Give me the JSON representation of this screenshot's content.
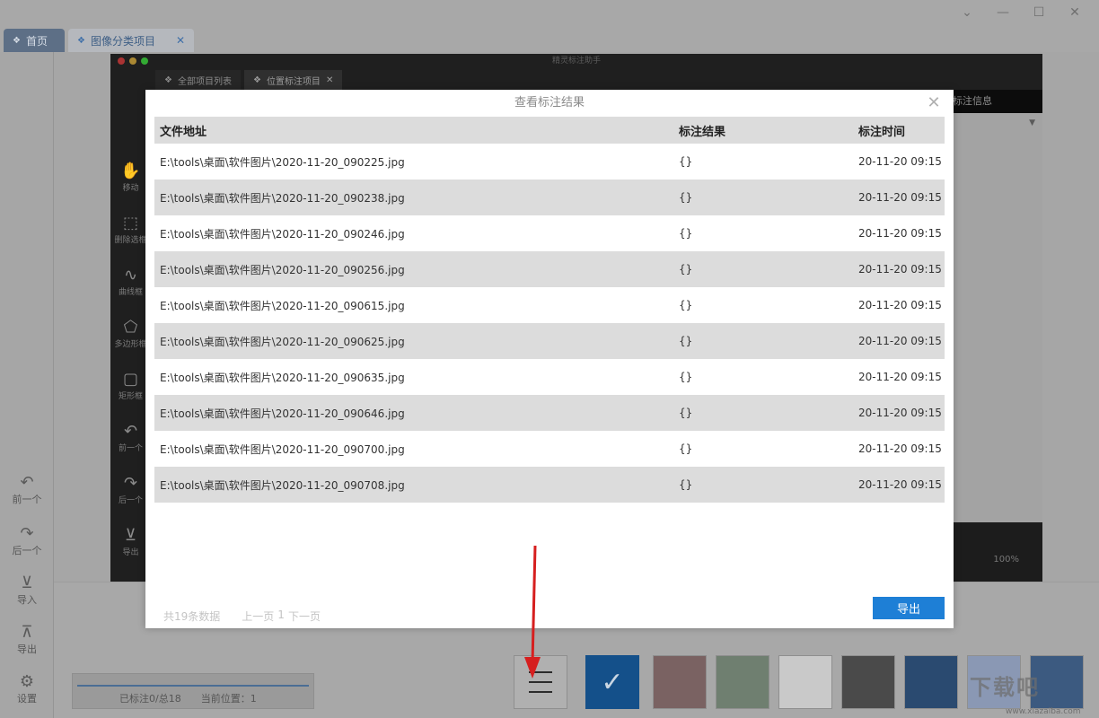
{
  "app": {
    "tabs": [
      {
        "label": "首页",
        "closable": false
      },
      {
        "label": "图像分类项目",
        "closable": true
      }
    ],
    "close_glyph": "✕"
  },
  "outer_sidebar": {
    "items": [
      {
        "label": "前一个",
        "icon": "undo-arrow-icon"
      },
      {
        "label": "后一个",
        "icon": "redo-arrow-icon"
      },
      {
        "label": "导入",
        "icon": "import-icon"
      },
      {
        "label": "导出",
        "icon": "export-icon"
      },
      {
        "label": "设置",
        "icon": "gear-icon"
      }
    ]
  },
  "inner_app": {
    "title": "精灵标注助手",
    "tabs": [
      {
        "label": "全部项目列表"
      },
      {
        "label": "位置标注项目"
      }
    ],
    "tools": [
      {
        "label": "移动",
        "icon": "hand-icon"
      },
      {
        "label": "删除选框",
        "icon": "delete-selection-icon"
      },
      {
        "label": "曲线框",
        "icon": "curve-icon"
      },
      {
        "label": "多边形框",
        "icon": "polygon-icon"
      },
      {
        "label": "矩形框",
        "icon": "rectangle-icon"
      },
      {
        "label": "前一个",
        "icon": "undo-arrow-icon"
      },
      {
        "label": "后一个",
        "icon": "redo-arrow-icon"
      },
      {
        "label": "导出",
        "icon": "export-icon"
      }
    ],
    "right_header": "标注信息",
    "zoom": "100%"
  },
  "status": {
    "labeled": "已标注0/总18",
    "position": "当前位置：1"
  },
  "modal": {
    "title": "查看标注结果",
    "columns": [
      "文件地址",
      "标注结果",
      "标注时间"
    ],
    "rows": [
      {
        "path": "E:\\tools\\桌面\\软件图片\\2020-11-20_090225.jpg",
        "result": "{}",
        "time": "20-11-20 09:15"
      },
      {
        "path": "E:\\tools\\桌面\\软件图片\\2020-11-20_090238.jpg",
        "result": "{}",
        "time": "20-11-20 09:15"
      },
      {
        "path": "E:\\tools\\桌面\\软件图片\\2020-11-20_090246.jpg",
        "result": "{}",
        "time": "20-11-20 09:15"
      },
      {
        "path": "E:\\tools\\桌面\\软件图片\\2020-11-20_090256.jpg",
        "result": "{}",
        "time": "20-11-20 09:15"
      },
      {
        "path": "E:\\tools\\桌面\\软件图片\\2020-11-20_090615.jpg",
        "result": "{}",
        "time": "20-11-20 09:15"
      },
      {
        "path": "E:\\tools\\桌面\\软件图片\\2020-11-20_090625.jpg",
        "result": "{}",
        "time": "20-11-20 09:15"
      },
      {
        "path": "E:\\tools\\桌面\\软件图片\\2020-11-20_090635.jpg",
        "result": "{}",
        "time": "20-11-20 09:15"
      },
      {
        "path": "E:\\tools\\桌面\\软件图片\\2020-11-20_090646.jpg",
        "result": "{}",
        "time": "20-11-20 09:15"
      },
      {
        "path": "E:\\tools\\桌面\\软件图片\\2020-11-20_090700.jpg",
        "result": "{}",
        "time": "20-11-20 09:15"
      },
      {
        "path": "E:\\tools\\桌面\\软件图片\\2020-11-20_090708.jpg",
        "result": "{}",
        "time": "20-11-20 09:15"
      }
    ],
    "total": "共19条数据",
    "prev": "上一页",
    "page": "1",
    "next": "下一页",
    "export_label": "导出"
  },
  "thumbnails": {
    "colors": [
      "#7a6262",
      "#6f7f70",
      "#c9c9c9",
      "#4a4a4a",
      "#2a4a70",
      "#8a98b4",
      "#3c5a80"
    ]
  },
  "watermark": {
    "text": "下载吧",
    "url": "www.xiazaiba.com"
  },
  "colors": {
    "accent": "#1e7fd6",
    "annotation_arrow": "#d61f1f",
    "check_button": "#14508a"
  }
}
